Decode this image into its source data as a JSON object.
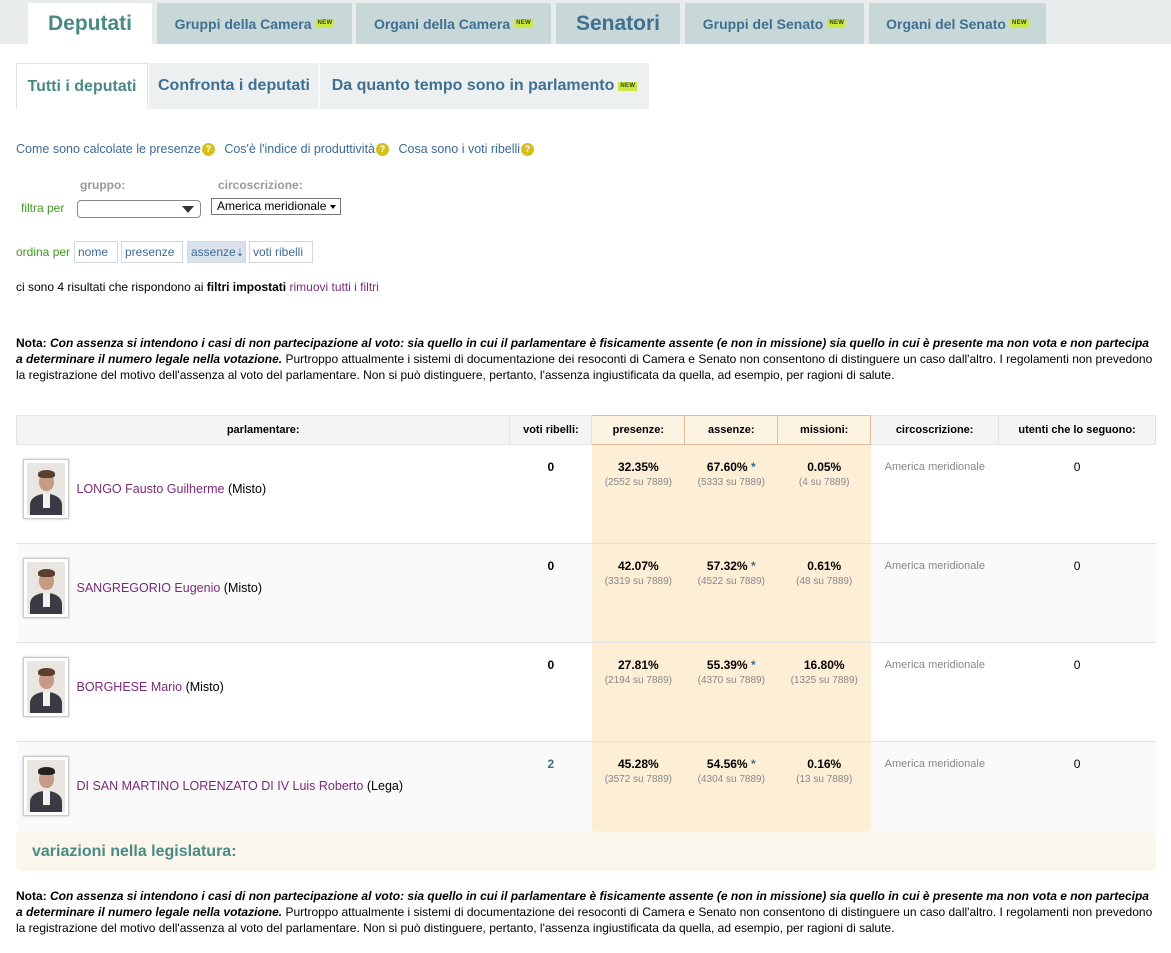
{
  "main_tabs": [
    {
      "label": "Deputati",
      "new": false
    },
    {
      "label": "Gruppi della Camera",
      "new": true
    },
    {
      "label": "Organi della Camera",
      "new": true
    },
    {
      "label": "Senatori",
      "new": false
    },
    {
      "label": "Gruppi del Senato",
      "new": true
    },
    {
      "label": "Organi del Senato",
      "new": true
    }
  ],
  "new_badge": "NEW",
  "sub_tabs": [
    {
      "label": "Tutti i deputati"
    },
    {
      "label": "Confronta i deputati"
    },
    {
      "label": "Da quanto tempo sono in parlamento"
    }
  ],
  "info_links": [
    {
      "label": "Come sono calcolate le presenze"
    },
    {
      "label": "Cos'è l'indice di produttività"
    },
    {
      "label": "Cosa sono i voti ribelli"
    }
  ],
  "help_glyph": "?",
  "filters": {
    "label": "filtra per",
    "gruppo_label": "gruppo:",
    "gruppo_value": "",
    "circoscrizione_label": "circoscrizione:",
    "circoscrizione_value": "America meridionale"
  },
  "sort": {
    "label": "ordina per",
    "options": [
      "nome",
      "presenze",
      "assenze",
      "voti ribelli"
    ],
    "active": "assenze",
    "active_arrow": "⇣"
  },
  "results": {
    "prefix": "ci sono 4 risultati che rispondono ai",
    "bold": "filtri impostati",
    "link": "rimuovi tutti i filtri"
  },
  "nota": {
    "label": "Nota:",
    "bold_text": "Con assenza si intendono i casi di non partecipazione al voto: sia quello in cui il parlamentare è fisicamente assente (e non in missione) sia quello in cui è presente ma non vota e non partecipa a determinare il numero legale nella votazione.",
    "text": "Purtroppo attualmente i sistemi di documentazione dei resoconti di Camera e Senato non consentono di distinguere un caso dall'altro. I regolamenti non prevedono la registrazione del motivo dell'assenza al voto del parlamentare. Non si può distinguere, pertanto, l'assenza ingiustificata da quella, ad esempio, per ragioni di salute."
  },
  "table": {
    "headers": [
      "parlamentare:",
      "voti ribelli:",
      "presenze:",
      "assenze:",
      "missioni:",
      "circoscrizione:",
      "utenti che lo seguono:"
    ],
    "rows": [
      {
        "name": "LONGO Fausto Guilherme",
        "group": "(Misto)",
        "ribelli": "0",
        "presenze": "32.35%",
        "presenze_sub": "(2552 su 7889)",
        "assenze": "67.60%",
        "assenze_sub": "(5333 su 7889)",
        "missioni": "0.05%",
        "missioni_sub": "(4 su 7889)",
        "circoscrizione": "America meridionale",
        "utenti": "0"
      },
      {
        "name": "SANGREGORIO Eugenio",
        "group": "(Misto)",
        "ribelli": "0",
        "presenze": "42.07%",
        "presenze_sub": "(3319 su 7889)",
        "assenze": "57.32%",
        "assenze_sub": "(4522 su 7889)",
        "missioni": "0.61%",
        "missioni_sub": "(48 su 7889)",
        "circoscrizione": "America meridionale",
        "utenti": "0"
      },
      {
        "name": "BORGHESE Mario",
        "group": "(Misto)",
        "ribelli": "0",
        "presenze": "27.81%",
        "presenze_sub": "(2194 su 7889)",
        "assenze": "55.39%",
        "assenze_sub": "(4370 su 7889)",
        "missioni": "16.80%",
        "missioni_sub": "(1325 su 7889)",
        "circoscrizione": "America meridionale",
        "utenti": "0"
      },
      {
        "name": "DI SAN MARTINO LORENZATO DI IV Luis Roberto",
        "group": "(Lega)",
        "ribelli": "2",
        "presenze": "45.28%",
        "presenze_sub": "(3572 su 7889)",
        "assenze": "54.56%",
        "assenze_sub": "(4304 su 7889)",
        "missioni": "0.16%",
        "missioni_sub": "(13 su 7889)",
        "circoscrizione": "America meridionale",
        "utenti": "0"
      }
    ],
    "star": "*"
  },
  "variazioni": {
    "title": "variazioni nella legislatura:"
  },
  "colors": {
    "accent_teal": "#4a8a84",
    "link_blue": "#3d6a96",
    "link_purple": "#7a2a7a",
    "highlight": "#fdeed6",
    "new_badge": "#cbe844"
  }
}
